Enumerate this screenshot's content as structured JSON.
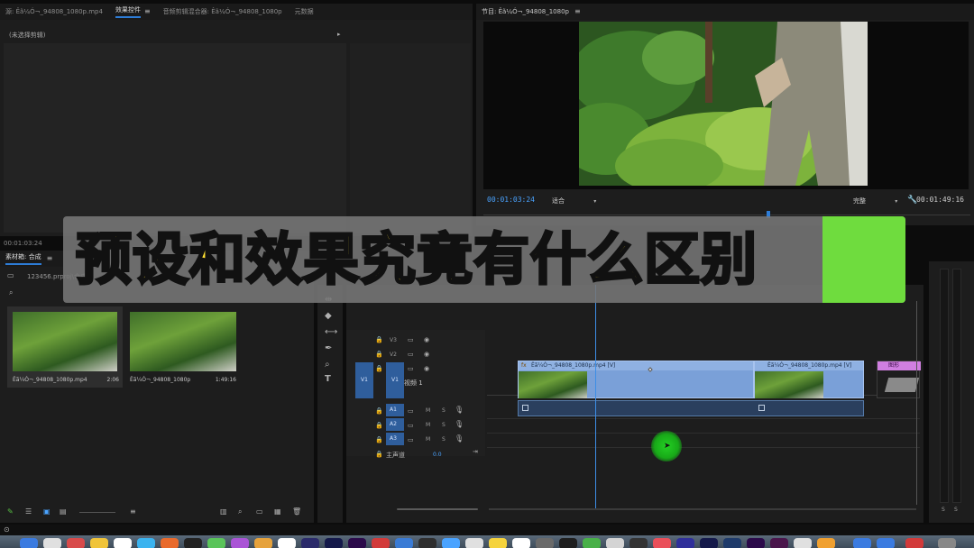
{
  "source_panel": {
    "tabs": [
      {
        "label": "源: Êã¼Ó¬_94808_1080p.mp4",
        "active": false
      },
      {
        "label": "效果控件",
        "active": true
      },
      {
        "label": "音频剪辑混合器: Êã¼Ó¬_94808_1080p",
        "active": false
      },
      {
        "label": "元数据",
        "active": false
      }
    ],
    "no_clip_text": "(未选择剪辑)",
    "timecode": "00:01:03:24"
  },
  "program_monitor": {
    "tab_label": "节目: Êã¼Ó¬_94808_1080p",
    "timecode_left": "00:01:03:24",
    "fit_label": "适合",
    "quality_label": "完整",
    "timecode_right": "00:01:49:16"
  },
  "project_panel": {
    "tab_label": "素材箱: 合成",
    "project_file": "123456.prproj\\合成",
    "items": [
      {
        "name": "Êã¼Ó¬_94808_1080p.mp4",
        "duration": "2:06"
      },
      {
        "name": "Êã¼Ó¬_94808_1080p",
        "duration": "1:49:16"
      }
    ]
  },
  "timeline": {
    "video_tracks": [
      "V3",
      "V2",
      "V1"
    ],
    "source_v1": "V1",
    "track_v1_name": "视频 1",
    "audio_tracks": [
      "A1",
      "A2",
      "A3"
    ],
    "master_label": "主声道",
    "master_value": "0.0",
    "toggle_m": "M",
    "toggle_s": "S",
    "clip1_label": "Êã¼Ó¬_94808_1080p.mp4 [V]",
    "clip2_label": "Êã¼Ó¬_94808_1080p.mp4 [V]",
    "clip3_label": "图形",
    "fx_badge": "fx"
  },
  "overlay": {
    "headline": "预设和效果究竟有什么区别"
  },
  "colors": {
    "accent_blue": "#2d7cd6",
    "headline_yellow": "#ffe033",
    "green_block": "#6fdc3e",
    "cursor_green": "#1ec81e"
  }
}
